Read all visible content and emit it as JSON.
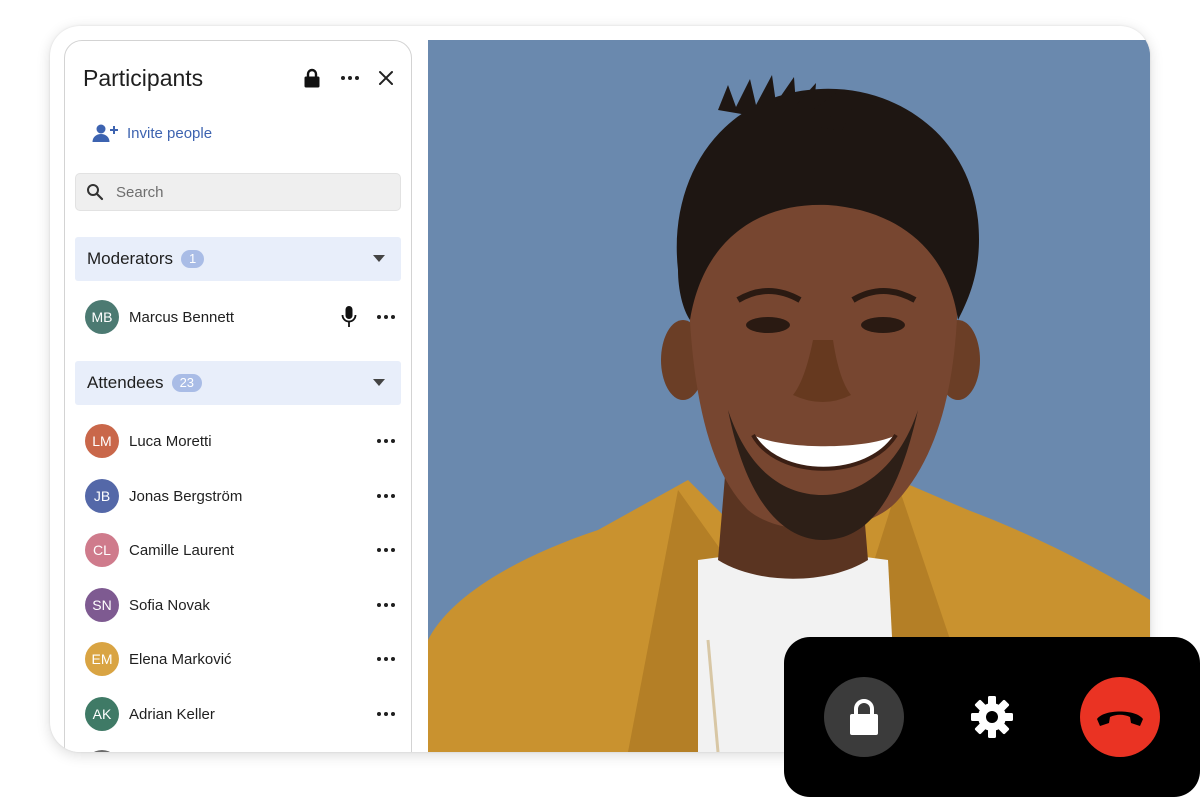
{
  "panel": {
    "title": "Participants",
    "invite_label": "Invite people",
    "search_placeholder": "Search",
    "header_icons": [
      "lock-icon",
      "more-icon",
      "close-icon"
    ]
  },
  "moderators": {
    "label": "Moderators",
    "count": "1",
    "people": [
      {
        "initials": "MB",
        "name": "Marcus Bennett",
        "color": "#4c7a72",
        "mic": true
      }
    ]
  },
  "attendees": {
    "label": "Attendees",
    "count": "23",
    "people": [
      {
        "initials": "LM",
        "name": "Luca Moretti",
        "color": "#c9674a"
      },
      {
        "initials": "JB",
        "name": "Jonas Bergström",
        "color": "#5468a8"
      },
      {
        "initials": "CL",
        "name": "Camille Laurent",
        "color": "#cf7b8c"
      },
      {
        "initials": "SN",
        "name": "Sofia Novak",
        "color": "#7e5a91"
      },
      {
        "initials": "EM",
        "name": "Elena Marković",
        "color": "#d9a443"
      },
      {
        "initials": "AK",
        "name": "Adrian Keller",
        "color": "#3f7a66"
      }
    ]
  },
  "controls": {
    "buttons": [
      "lock-icon",
      "gear-icon",
      "hang-up-icon"
    ],
    "hangup_color": "#ea3323"
  },
  "colors": {
    "accent": "#3d63b0",
    "section_bg": "#e8eefa",
    "video_bg": "#6a89ae"
  }
}
